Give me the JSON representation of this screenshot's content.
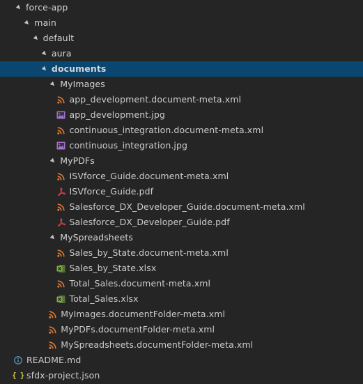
{
  "colors": {
    "background": "#252526",
    "selection": "#094771",
    "text": "#cccccc",
    "rss_icon": "#e37933",
    "image_icon": "#a074c4",
    "pdf_icon": "#cc3e44",
    "excel_icon": "#7fae42",
    "info_icon": "#519aba",
    "json_icon": "#cbcb41"
  },
  "tree": [
    {
      "label": "force-app",
      "kind": "folder",
      "depth": 0,
      "icon": "chevron-down-icon"
    },
    {
      "label": "main",
      "kind": "folder",
      "depth": 1,
      "icon": "chevron-down-icon"
    },
    {
      "label": "default",
      "kind": "folder",
      "depth": 2,
      "icon": "chevron-down-icon"
    },
    {
      "label": "aura",
      "kind": "folder",
      "depth": 3,
      "icon": "chevron-down-icon"
    },
    {
      "label": "documents",
      "kind": "folder",
      "depth": 3,
      "icon": "chevron-down-icon",
      "selected": true
    },
    {
      "label": "MyImages",
      "kind": "folder",
      "depth": 4,
      "icon": "chevron-down-icon"
    },
    {
      "label": "app_development.document-meta.xml",
      "kind": "file",
      "depth": 5,
      "icon": "rss-icon"
    },
    {
      "label": "app_development.jpg",
      "kind": "file",
      "depth": 5,
      "icon": "image-icon"
    },
    {
      "label": "continuous_integration.document-meta.xml",
      "kind": "file",
      "depth": 5,
      "icon": "rss-icon"
    },
    {
      "label": "continuous_integration.jpg",
      "kind": "file",
      "depth": 5,
      "icon": "image-icon"
    },
    {
      "label": "MyPDFs",
      "kind": "folder",
      "depth": 4,
      "icon": "chevron-down-icon"
    },
    {
      "label": "ISVforce_Guide.document-meta.xml",
      "kind": "file",
      "depth": 5,
      "icon": "rss-icon"
    },
    {
      "label": "ISVforce_Guide.pdf",
      "kind": "file",
      "depth": 5,
      "icon": "pdf-icon"
    },
    {
      "label": "Salesforce_DX_Developer_Guide.document-meta.xml",
      "kind": "file",
      "depth": 5,
      "icon": "rss-icon"
    },
    {
      "label": "Salesforce_DX_Developer_Guide.pdf",
      "kind": "file",
      "depth": 5,
      "icon": "pdf-icon"
    },
    {
      "label": "MySpreadsheets",
      "kind": "folder",
      "depth": 4,
      "icon": "chevron-down-icon"
    },
    {
      "label": "Sales_by_State.document-meta.xml",
      "kind": "file",
      "depth": 5,
      "icon": "rss-icon"
    },
    {
      "label": "Sales_by_State.xlsx",
      "kind": "file",
      "depth": 5,
      "icon": "excel-icon"
    },
    {
      "label": "Total_Sales.document-meta.xml",
      "kind": "file",
      "depth": 5,
      "icon": "rss-icon"
    },
    {
      "label": "Total_Sales.xlsx",
      "kind": "file",
      "depth": 5,
      "icon": "excel-icon"
    },
    {
      "label": "MyImages.documentFolder-meta.xml",
      "kind": "file",
      "depth": 4,
      "icon": "rss-icon"
    },
    {
      "label": "MyPDFs.documentFolder-meta.xml",
      "kind": "file",
      "depth": 4,
      "icon": "rss-icon"
    },
    {
      "label": "MySpreadsheets.documentFolder-meta.xml",
      "kind": "file",
      "depth": 4,
      "icon": "rss-icon"
    },
    {
      "label": "README.md",
      "kind": "file",
      "depth": 0,
      "icon": "info-icon"
    },
    {
      "label": "sfdx-project.json",
      "kind": "file",
      "depth": 0,
      "icon": "json-icon"
    }
  ]
}
